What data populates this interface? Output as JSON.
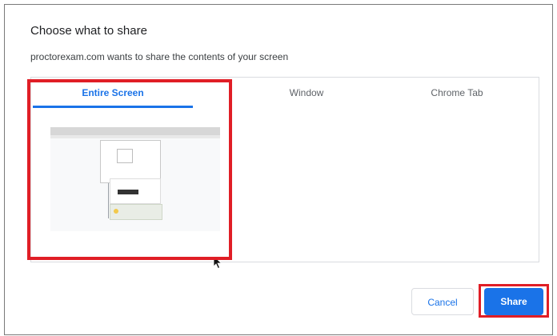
{
  "dialog": {
    "title": "Choose what to share",
    "subtitle": "proctorexam.com wants to share the contents of your screen"
  },
  "tabs": [
    {
      "label": "Entire Screen",
      "active": true
    },
    {
      "label": "Window",
      "active": false
    },
    {
      "label": "Chrome Tab",
      "active": false
    }
  ],
  "buttons": {
    "cancel_label": "Cancel",
    "share_label": "Share"
  },
  "colors": {
    "accent": "#1a73e8",
    "highlight": "#e01e26"
  },
  "icons": {
    "cursor": "mouse-pointer-icon"
  }
}
